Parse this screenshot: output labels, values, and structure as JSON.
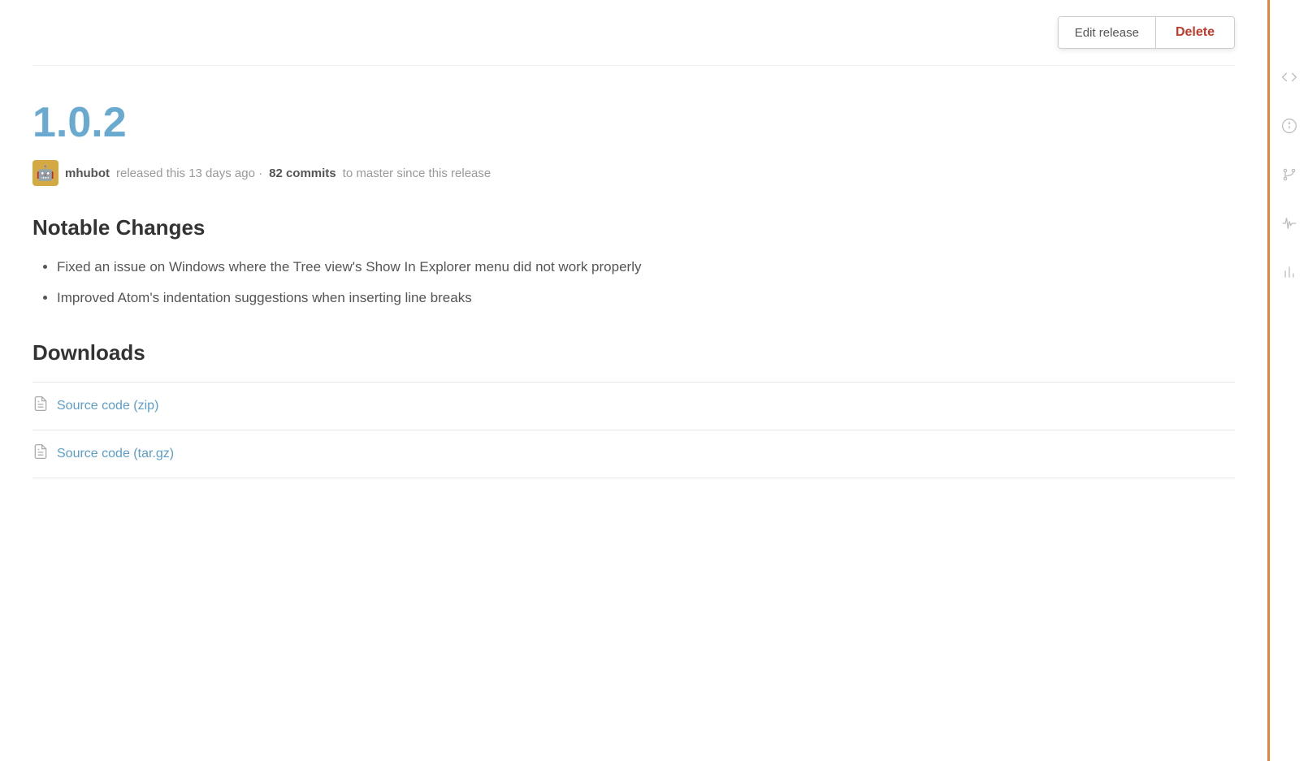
{
  "header": {
    "edit_release_label": "Edit release",
    "delete_label": "Delete"
  },
  "release": {
    "version": "1.0.2",
    "avatar_icon": "🤖",
    "username": "mhubot",
    "meta_text": "released this 13 days ago · ",
    "commits_count": "82 commits",
    "commits_suffix": " to master since this release"
  },
  "notable_changes": {
    "title": "Notable Changes",
    "items": [
      "Fixed an issue on Windows where the Tree view's Show In Explorer menu did not work properly",
      "Improved Atom's indentation suggestions when inserting line breaks"
    ]
  },
  "downloads": {
    "title": "Downloads",
    "items": [
      {
        "label": "Source code",
        "suffix": " (zip)",
        "href": "#"
      },
      {
        "label": "Source code",
        "suffix": " (tar.gz)",
        "href": "#"
      }
    ]
  },
  "sidebar": {
    "icons": [
      {
        "name": "code-icon",
        "symbol": "<>"
      },
      {
        "name": "info-icon",
        "symbol": "ℹ"
      },
      {
        "name": "merge-icon",
        "symbol": "⑂"
      },
      {
        "name": "pulse-icon",
        "symbol": "⌇"
      },
      {
        "name": "stats-icon",
        "symbol": "▌▌▌"
      }
    ]
  }
}
